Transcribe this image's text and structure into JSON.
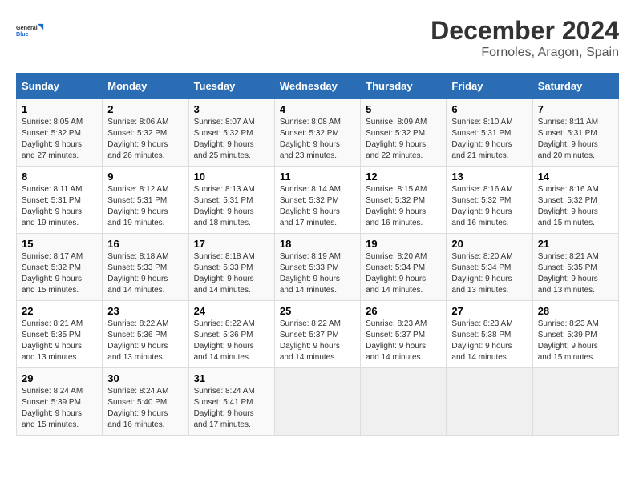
{
  "logo": {
    "line1": "General",
    "line2": "Blue"
  },
  "title": "December 2024",
  "location": "Fornoles, Aragon, Spain",
  "headers": [
    "Sunday",
    "Monday",
    "Tuesday",
    "Wednesday",
    "Thursday",
    "Friday",
    "Saturday"
  ],
  "weeks": [
    [
      {
        "day": "1",
        "sunrise": "8:05 AM",
        "sunset": "5:32 PM",
        "daylight": "9 hours and 27 minutes."
      },
      {
        "day": "2",
        "sunrise": "8:06 AM",
        "sunset": "5:32 PM",
        "daylight": "9 hours and 26 minutes."
      },
      {
        "day": "3",
        "sunrise": "8:07 AM",
        "sunset": "5:32 PM",
        "daylight": "9 hours and 25 minutes."
      },
      {
        "day": "4",
        "sunrise": "8:08 AM",
        "sunset": "5:32 PM",
        "daylight": "9 hours and 23 minutes."
      },
      {
        "day": "5",
        "sunrise": "8:09 AM",
        "sunset": "5:32 PM",
        "daylight": "9 hours and 22 minutes."
      },
      {
        "day": "6",
        "sunrise": "8:10 AM",
        "sunset": "5:31 PM",
        "daylight": "9 hours and 21 minutes."
      },
      {
        "day": "7",
        "sunrise": "8:11 AM",
        "sunset": "5:31 PM",
        "daylight": "9 hours and 20 minutes."
      }
    ],
    [
      {
        "day": "8",
        "sunrise": "8:11 AM",
        "sunset": "5:31 PM",
        "daylight": "9 hours and 19 minutes."
      },
      {
        "day": "9",
        "sunrise": "8:12 AM",
        "sunset": "5:31 PM",
        "daylight": "9 hours and 19 minutes."
      },
      {
        "day": "10",
        "sunrise": "8:13 AM",
        "sunset": "5:31 PM",
        "daylight": "9 hours and 18 minutes."
      },
      {
        "day": "11",
        "sunrise": "8:14 AM",
        "sunset": "5:32 PM",
        "daylight": "9 hours and 17 minutes."
      },
      {
        "day": "12",
        "sunrise": "8:15 AM",
        "sunset": "5:32 PM",
        "daylight": "9 hours and 16 minutes."
      },
      {
        "day": "13",
        "sunrise": "8:16 AM",
        "sunset": "5:32 PM",
        "daylight": "9 hours and 16 minutes."
      },
      {
        "day": "14",
        "sunrise": "8:16 AM",
        "sunset": "5:32 PM",
        "daylight": "9 hours and 15 minutes."
      }
    ],
    [
      {
        "day": "15",
        "sunrise": "8:17 AM",
        "sunset": "5:32 PM",
        "daylight": "9 hours and 15 minutes."
      },
      {
        "day": "16",
        "sunrise": "8:18 AM",
        "sunset": "5:33 PM",
        "daylight": "9 hours and 14 minutes."
      },
      {
        "day": "17",
        "sunrise": "8:18 AM",
        "sunset": "5:33 PM",
        "daylight": "9 hours and 14 minutes."
      },
      {
        "day": "18",
        "sunrise": "8:19 AM",
        "sunset": "5:33 PM",
        "daylight": "9 hours and 14 minutes."
      },
      {
        "day": "19",
        "sunrise": "8:20 AM",
        "sunset": "5:34 PM",
        "daylight": "9 hours and 14 minutes."
      },
      {
        "day": "20",
        "sunrise": "8:20 AM",
        "sunset": "5:34 PM",
        "daylight": "9 hours and 13 minutes."
      },
      {
        "day": "21",
        "sunrise": "8:21 AM",
        "sunset": "5:35 PM",
        "daylight": "9 hours and 13 minutes."
      }
    ],
    [
      {
        "day": "22",
        "sunrise": "8:21 AM",
        "sunset": "5:35 PM",
        "daylight": "9 hours and 13 minutes."
      },
      {
        "day": "23",
        "sunrise": "8:22 AM",
        "sunset": "5:36 PM",
        "daylight": "9 hours and 13 minutes."
      },
      {
        "day": "24",
        "sunrise": "8:22 AM",
        "sunset": "5:36 PM",
        "daylight": "9 hours and 14 minutes."
      },
      {
        "day": "25",
        "sunrise": "8:22 AM",
        "sunset": "5:37 PM",
        "daylight": "9 hours and 14 minutes."
      },
      {
        "day": "26",
        "sunrise": "8:23 AM",
        "sunset": "5:37 PM",
        "daylight": "9 hours and 14 minutes."
      },
      {
        "day": "27",
        "sunrise": "8:23 AM",
        "sunset": "5:38 PM",
        "daylight": "9 hours and 14 minutes."
      },
      {
        "day": "28",
        "sunrise": "8:23 AM",
        "sunset": "5:39 PM",
        "daylight": "9 hours and 15 minutes."
      }
    ],
    [
      {
        "day": "29",
        "sunrise": "8:24 AM",
        "sunset": "5:39 PM",
        "daylight": "9 hours and 15 minutes."
      },
      {
        "day": "30",
        "sunrise": "8:24 AM",
        "sunset": "5:40 PM",
        "daylight": "9 hours and 16 minutes."
      },
      {
        "day": "31",
        "sunrise": "8:24 AM",
        "sunset": "5:41 PM",
        "daylight": "9 hours and 17 minutes."
      },
      null,
      null,
      null,
      null
    ]
  ],
  "labels": {
    "sunrise": "Sunrise: ",
    "sunset": "Sunset: ",
    "daylight": "Daylight: "
  }
}
